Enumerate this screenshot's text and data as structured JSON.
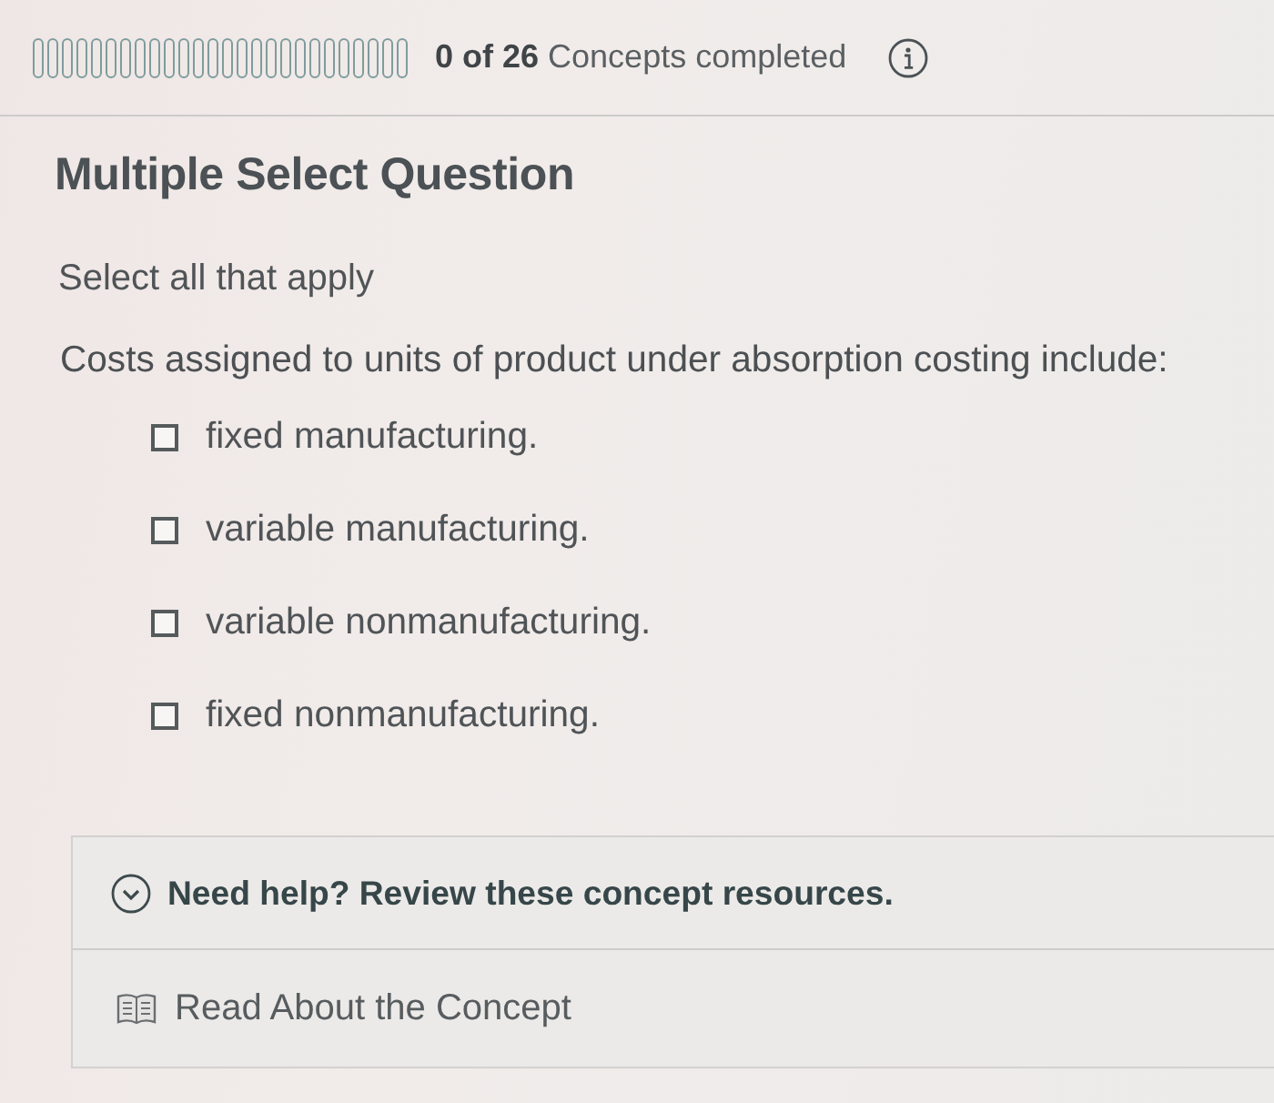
{
  "progress": {
    "segments": [
      {
        "completed": false
      },
      {
        "completed": false
      },
      {
        "completed": false
      },
      {
        "completed": false
      },
      {
        "completed": false
      },
      {
        "completed": false
      },
      {
        "completed": false
      },
      {
        "completed": false
      },
      {
        "completed": false
      },
      {
        "completed": false
      },
      {
        "completed": false
      },
      {
        "completed": false
      },
      {
        "completed": false
      },
      {
        "completed": false
      },
      {
        "completed": false
      },
      {
        "completed": false
      },
      {
        "completed": false
      },
      {
        "completed": false
      },
      {
        "completed": false
      },
      {
        "completed": false
      },
      {
        "completed": false
      },
      {
        "completed": false
      },
      {
        "completed": false
      },
      {
        "completed": false
      },
      {
        "completed": false
      },
      {
        "completed": false
      }
    ],
    "count": "0 of 26",
    "label": "Concepts completed"
  },
  "question": {
    "type": "Multiple Select Question",
    "instruction": "Select all that apply",
    "prompt": "Costs assigned to units of product under absorption costing include:",
    "options": [
      {
        "label": "fixed manufacturing.",
        "checked": false
      },
      {
        "label": "variable manufacturing.",
        "checked": false
      },
      {
        "label": "variable nonmanufacturing.",
        "checked": false
      },
      {
        "label": "fixed nonmanufacturing.",
        "checked": false
      }
    ]
  },
  "help": {
    "title": "Need help? Review these concept resources.",
    "resources": [
      {
        "label": "Read About the Concept"
      }
    ]
  }
}
